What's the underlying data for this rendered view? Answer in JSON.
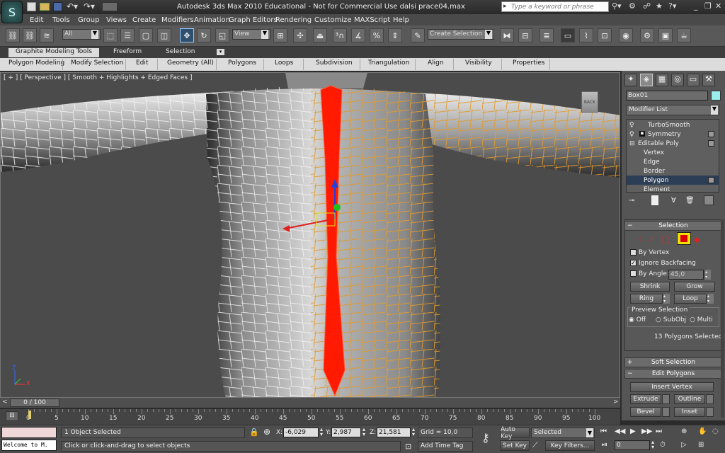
{
  "title": "Autodesk 3ds Max  2010   Educational - Not for Commercial Use    dalsi prace04.max",
  "search_placeholder": "Type a keyword or phrase",
  "menu": [
    "Edit",
    "Tools",
    "Group",
    "Views",
    "Create",
    "Modifiers",
    "Animation",
    "Graph Editors",
    "Rendering",
    "Customize",
    "MAXScript",
    "Help"
  ],
  "toolbar": {
    "filter_value": "All",
    "refcoord_value": "View",
    "selection_set_value": "Create Selection Se"
  },
  "ribbon_tabs": [
    "Graphite Modeling Tools",
    "Freeform",
    "Selection"
  ],
  "ribbon_items": [
    "Polygon Modeling",
    "Modify Selection",
    "Edit",
    "Geometry (All)",
    "Polygons",
    "Loops",
    "Subdivision",
    "Triangulation",
    "Align",
    "Visibility",
    "Properties"
  ],
  "viewport": {
    "label": "[ + ] [ Perspective ] [ Smooth + Highlights + Edged Faces ]",
    "viewcube_label": "BACK",
    "axis_x": "X",
    "axis_z": "Z"
  },
  "cmdpanel": {
    "object_name": "Box01",
    "modifier_list": "Modifier List",
    "stack": [
      "TurboSmooth",
      "Symmetry",
      "Editable Poly",
      "Vertex",
      "Edge",
      "Border",
      "Polygon",
      "Element"
    ],
    "selected_stack_item": "Polygon",
    "selection_title": "Selection",
    "by_vertex": "By Vertex",
    "ignore_backfacing": "Ignore Backfacing",
    "by_angle": "By Angle:",
    "by_angle_value": "45,0",
    "shrink": "Shrink",
    "grow": "Grow",
    "ring": "Ring",
    "loop": "Loop",
    "preview_title": "Preview Selection",
    "preview_off": "Off",
    "preview_subobj": "SubObj",
    "preview_multi": "Multi",
    "selected_count": "13 Polygons Selected",
    "soft_selection": "Soft Selection",
    "edit_polygons": "Edit Polygons",
    "insert_vertex": "Insert Vertex",
    "extrude": "Extrude",
    "outline": "Outline",
    "bevel": "Bevel",
    "inset": "Inset"
  },
  "timeline": {
    "frame_display": "0 / 100",
    "ticks": [
      "0",
      "5",
      "10",
      "15",
      "20",
      "25",
      "30",
      "35",
      "40",
      "45",
      "50",
      "55",
      "60",
      "65",
      "70",
      "75",
      "80",
      "85",
      "90",
      "95",
      "100"
    ],
    "start": 0,
    "end": 100,
    "current": 0
  },
  "status": {
    "maxscript": "Welcome to M.",
    "selected": "1 Object Selected",
    "prompt": "Click or click-and-drag to select objects",
    "x_label": "X:",
    "x_value": "-6,029",
    "y_label": "Y:",
    "y_value": "2,987",
    "z_label": "Z:",
    "z_value": "21,581",
    "grid": "Grid = 10,0",
    "add_time_tag": "Add Time Tag",
    "auto_key": "Auto Key",
    "set_key": "Set Key",
    "key_mode_value": "Selected",
    "key_filters": "Key Filters...",
    "frame_value": "0"
  },
  "colors": {
    "selection_red": "#ff1a00",
    "wire_orange": "#e39a2a",
    "wire_white": "#f2f2f2"
  }
}
